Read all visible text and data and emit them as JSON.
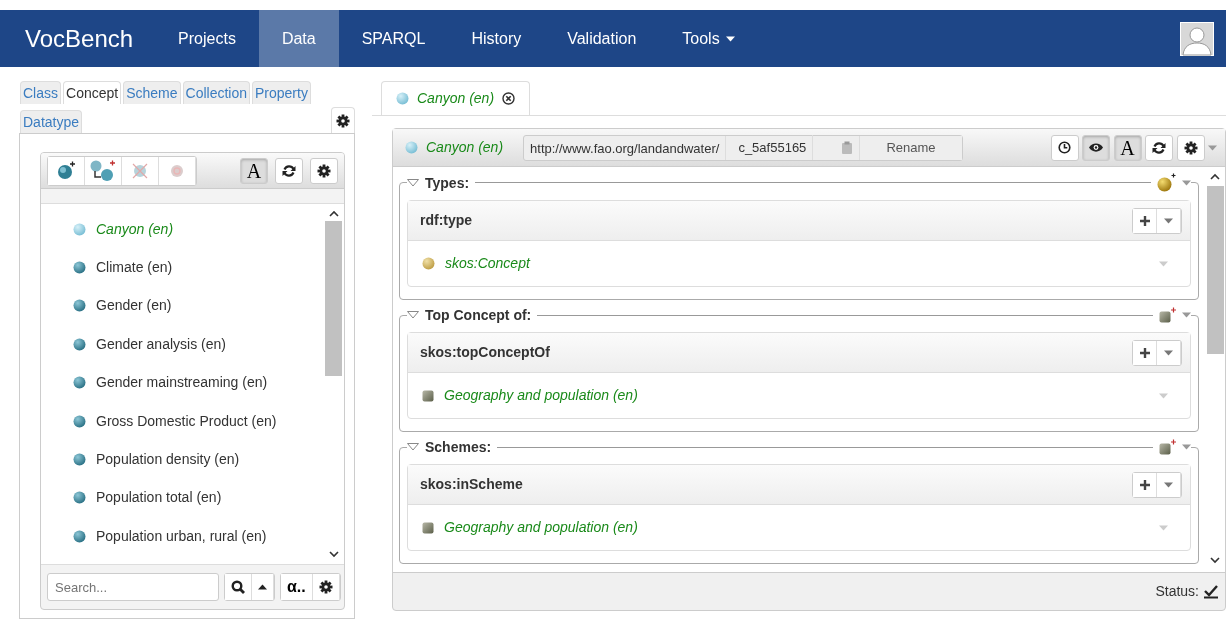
{
  "navbar": {
    "brand": "VocBench",
    "items": [
      {
        "label": "Projects",
        "selected": false,
        "dropdown": false
      },
      {
        "label": "Data",
        "selected": true,
        "dropdown": false
      },
      {
        "label": "SPARQL",
        "selected": false,
        "dropdown": false
      },
      {
        "label": "History",
        "selected": false,
        "dropdown": false
      },
      {
        "label": "Validation",
        "selected": false,
        "dropdown": false
      },
      {
        "label": "Tools",
        "selected": false,
        "dropdown": true
      }
    ]
  },
  "left_panel": {
    "tabs": [
      {
        "label": "Class",
        "selected": false
      },
      {
        "label": "Concept",
        "selected": true
      },
      {
        "label": "Scheme",
        "selected": false
      },
      {
        "label": "Collection",
        "selected": false
      },
      {
        "label": "Property",
        "selected": false
      },
      {
        "label": "Datatype",
        "selected": false
      }
    ],
    "toolbar": {
      "buttons": [
        {
          "kind": "create_concept",
          "disabled": false
        },
        {
          "kind": "create_narrower",
          "disabled": false
        },
        {
          "kind": "delete",
          "disabled": true
        },
        {
          "kind": "deprecate",
          "disabled": true
        }
      ],
      "language_toggle": {
        "label": "A",
        "on": true
      }
    },
    "concepts": [
      {
        "label": "Canyon (en)",
        "local": true
      },
      {
        "label": "Climate (en)",
        "local": false
      },
      {
        "label": "Gender (en)",
        "local": false
      },
      {
        "label": "Gender analysis (en)",
        "local": false
      },
      {
        "label": "Gender mainstreaming (en)",
        "local": false
      },
      {
        "label": "Gross Domestic Product (en)",
        "local": false
      },
      {
        "label": "Population density (en)",
        "local": false
      },
      {
        "label": "Population total (en)",
        "local": false
      },
      {
        "label": "Population urban, rural (en)",
        "local": false
      }
    ],
    "search": {
      "placeholder": "Search..."
    },
    "sort_button": "α.."
  },
  "editor": {
    "tabs": [
      {
        "label": "Canyon (en)",
        "selected": true
      }
    ],
    "header": {
      "label": "Canyon (en)",
      "namespace": "http://www.fao.org/landandwater/",
      "local_name": "c_5af55165",
      "rename_button": "Rename",
      "toggles": [
        {
          "kind": "history",
          "on": false
        },
        {
          "kind": "inferred",
          "on": true
        },
        {
          "kind": "language",
          "label": "A",
          "on": true
        },
        {
          "kind": "refresh",
          "on": false
        },
        {
          "kind": "settings",
          "on": false
        }
      ]
    },
    "sections": [
      {
        "title": "Types:",
        "kind": "class",
        "properties": [
          {
            "name": "rdf:type",
            "values": [
              {
                "label": "skos:Concept",
                "kind": "class"
              }
            ]
          }
        ]
      },
      {
        "title": "Top Concept of:",
        "kind": "scheme",
        "properties": [
          {
            "name": "skos:topConceptOf",
            "values": [
              {
                "label": "Geography and population (en)",
                "kind": "scheme"
              }
            ]
          }
        ]
      },
      {
        "title": "Schemes:",
        "kind": "scheme",
        "properties": [
          {
            "name": "skos:inScheme",
            "values": [
              {
                "label": "Geography and population (en)",
                "kind": "scheme"
              }
            ]
          }
        ]
      }
    ],
    "status": "Status:"
  }
}
